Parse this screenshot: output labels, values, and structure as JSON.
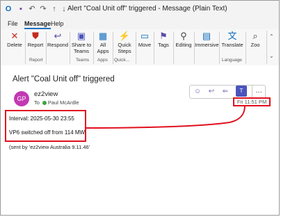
{
  "window": {
    "title": "Alert \"Coal Unit off\" triggered  -  Message (Plain Text)"
  },
  "menu": {
    "tabs": [
      "File",
      "Message",
      "Help"
    ]
  },
  "ribbon": {
    "buttons": [
      {
        "label": "Delete",
        "icon": "delete-x-icon"
      },
      {
        "label": "Report",
        "icon": "report-shield-icon"
      },
      {
        "label": "Respond",
        "icon": "respond-icon"
      },
      {
        "label": "Share to Teams",
        "icon": "teams-icon"
      },
      {
        "label": "All Apps",
        "icon": "apps-grid-icon"
      },
      {
        "label": "Quick Steps",
        "icon": "lightning-icon"
      },
      {
        "label": "Move",
        "icon": "folder-move-icon"
      },
      {
        "label": "Tags",
        "icon": "tag-icon"
      },
      {
        "label": "Editing",
        "icon": "search-icon"
      },
      {
        "label": "Immersive",
        "icon": "immersive-reader-icon"
      },
      {
        "label": "Translate",
        "icon": "translate-icon"
      },
      {
        "label": "Zoo",
        "icon": "zoom-icon"
      }
    ],
    "groups": [
      "Report",
      "Teams",
      "Apps",
      "Quick...",
      "Language"
    ]
  },
  "message": {
    "subject": "Alert \"Coal Unit off\" triggered",
    "avatar_initials": "GP",
    "sender": "ez2view",
    "to_label": "To",
    "recipient": "Paul McArdle",
    "timestamp": "Fri 11:51 PM",
    "body_lines": [
      "Interval: 2025-05-30 23:55",
      "VP6 switched off from 114 MW"
    ],
    "signature": "(sent by 'ez2view Australia 9.11.46'"
  },
  "colors": {
    "highlight": "#e0101e",
    "avatar": "#c239b3",
    "accent": "#1f6fbf"
  }
}
